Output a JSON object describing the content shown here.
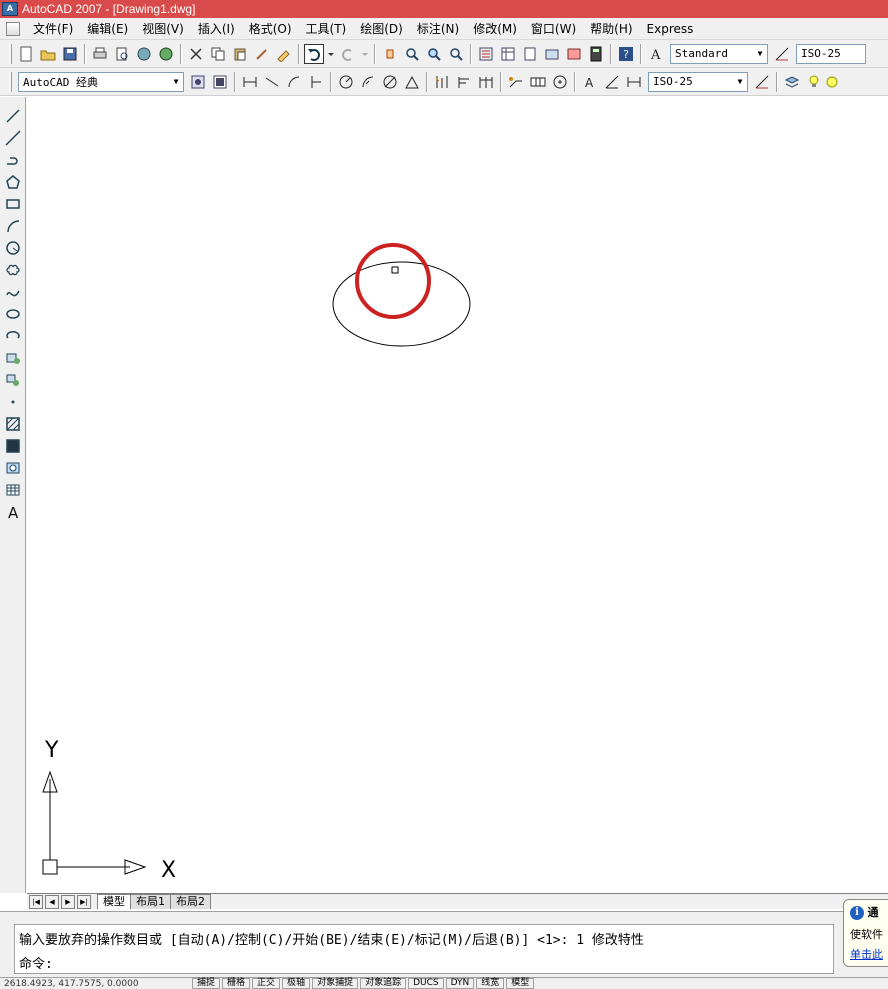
{
  "window": {
    "title": "AutoCAD 2007 - [Drawing1.dwg]",
    "app_icon_text": "A"
  },
  "menu": {
    "items": [
      "文件(F)",
      "编辑(E)",
      "视图(V)",
      "插入(I)",
      "格式(O)",
      "工具(T)",
      "绘图(D)",
      "标注(N)",
      "修改(M)",
      "窗口(W)",
      "帮助(H)",
      "Express"
    ]
  },
  "toolbar1": {
    "text_style": "Standard",
    "dim_style": "ISO-25"
  },
  "toolbar2": {
    "workspace": "AutoCAD 经典",
    "dim_style": "ISO-25"
  },
  "tabs": [
    "模型",
    "布局1",
    "布局2"
  ],
  "ucs": {
    "y_label": "Y",
    "x_label": "X"
  },
  "command": {
    "line1": "输入要放弃的操作数目或 [自动(A)/控制(C)/开始(BE)/结束(E)/标记(M)/后退(B)] <1>: 1 修改特性",
    "line2": "命令:"
  },
  "balloon": {
    "title": "通",
    "text": "使软件",
    "link": "单击此"
  },
  "statusbar": {
    "coords": "2618.4923, 417.7575, 0.0000",
    "buttons": [
      "捕捉",
      "栅格",
      "正交",
      "极轴",
      "对象捕捉",
      "对象追踪",
      "DUCS",
      "DYN",
      "线宽",
      "模型"
    ]
  },
  "colors": {
    "titlebar": "#d94a4a",
    "highlight_circle": "#cc2222"
  }
}
